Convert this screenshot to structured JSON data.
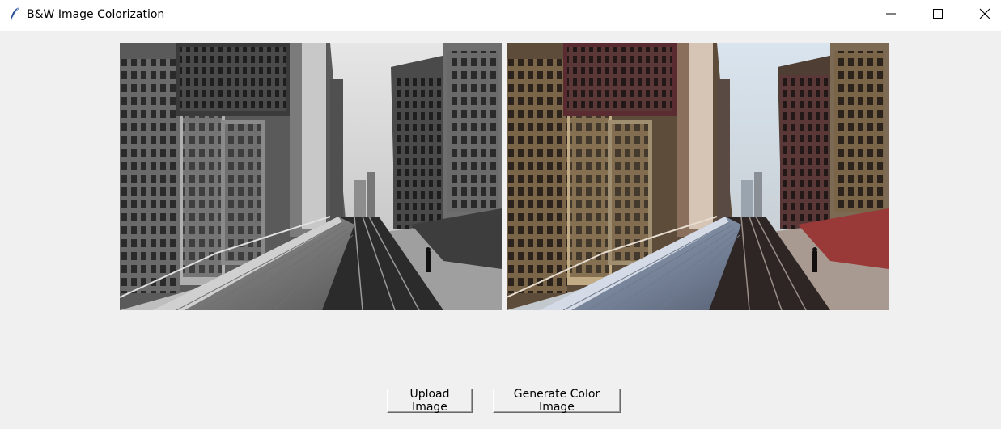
{
  "window": {
    "title": "B&W Image Colorization",
    "controls": [
      "minimize-icon",
      "maximize-icon",
      "close-icon"
    ]
  },
  "images": {
    "left": {
      "kind": "grayscale photo of city street with elevated train"
    },
    "right": {
      "kind": "colorized photo of city street with elevated train"
    }
  },
  "buttons": {
    "upload_label": "Upload Image",
    "generate_label": "Generate Color Image"
  },
  "colors": {
    "background": "#f0f0f0",
    "titlebar": "#ffffff"
  }
}
